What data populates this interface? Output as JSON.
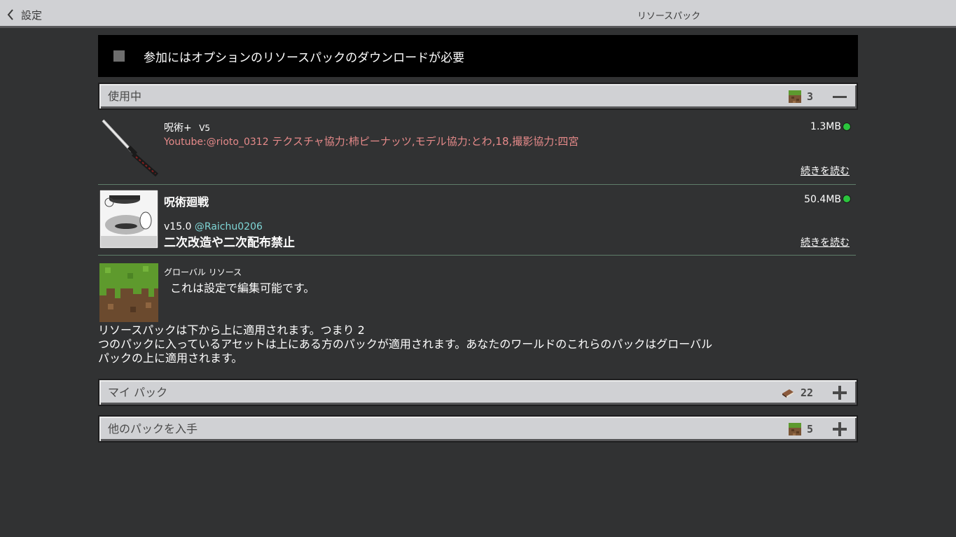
{
  "header": {
    "back_label": "設定",
    "title": "リソースパック"
  },
  "notice": {
    "text": "参加にはオプションのリソースパックのダウンロードが必要",
    "checked": false
  },
  "active_section": {
    "title": "使用中",
    "count": "3",
    "count_icon": "grass-block-icon",
    "action_icon": "minus-icon"
  },
  "packs": [
    {
      "name": "呪術+",
      "version": "V5",
      "desc_line1": "Youtube:@rioto_0312",
      "desc_line2": "テクスチャ協力:柿ピーナッツ,モデル協力:とわ,18,撮影協力:四宮",
      "size": "1.3MB",
      "status_color": "#2bc43d",
      "more": "続きを読む"
    },
    {
      "name": "呪術廻戦",
      "version_line": "v15.0",
      "author": "@Raichu0206",
      "warning": "二次改造や二次配布禁止",
      "size": "50.4MB",
      "status_color": "#2bc43d",
      "more": "続きを読む"
    },
    {
      "name": "グローバル リソース",
      "desc": "これは設定で編集可能です。"
    }
  ],
  "info_text": {
    "line1": "リソースパックは下から上に適用されます。つまり 2",
    "line2": "つのパックに入っているアセットは上にある方のパックが適用されます。あなたのワールドのこれらのパックはグローバル",
    "line3": "パックの上に適用されます。"
  },
  "my_packs_section": {
    "title": "マイ パック",
    "count": "22",
    "count_icon": "book-icon",
    "action_icon": "plus-icon"
  },
  "get_more_section": {
    "title": "他のパックを入手",
    "count": "5",
    "count_icon": "grass-block-icon",
    "action_icon": "plus-icon"
  },
  "colors": {
    "background": "#313233",
    "panel": "#d0d1d4",
    "accent_red": "#e68a8a",
    "accent_teal": "#7fd6d6",
    "status_green": "#2bc43d"
  }
}
